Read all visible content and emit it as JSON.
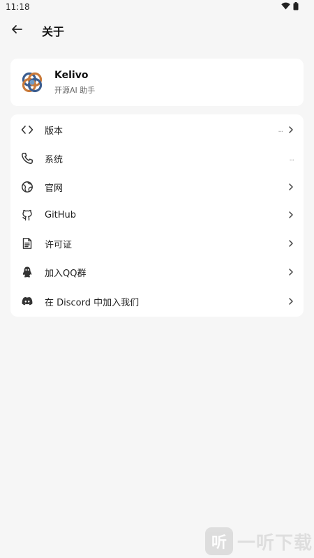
{
  "status": {
    "time": "11:18",
    "icons": [
      "wifi-icon",
      "battery-icon"
    ]
  },
  "header": {
    "title": "关于",
    "back_icon": "arrow-left-icon"
  },
  "app": {
    "name": "Kelivo",
    "description": "开源AI 助手",
    "logo_colors": [
      "#3b5d8f",
      "#c97a3a",
      "#6f9cc9"
    ]
  },
  "menu": {
    "items": [
      {
        "icon": "code-icon",
        "label": "版本",
        "value": "...",
        "chevron": true
      },
      {
        "icon": "phone-icon",
        "label": "系统",
        "value": "...",
        "chevron": false
      },
      {
        "icon": "globe-icon",
        "label": "官网",
        "value": "",
        "chevron": true
      },
      {
        "icon": "github-icon",
        "label": "GitHub",
        "value": "",
        "chevron": true
      },
      {
        "icon": "document-icon",
        "label": "许可证",
        "value": "",
        "chevron": true
      },
      {
        "icon": "qq-icon",
        "label": "加入QQ群",
        "value": "",
        "chevron": true
      },
      {
        "icon": "discord-icon",
        "label": "在 Discord 中加入我们",
        "value": "",
        "chevron": true
      }
    ]
  },
  "watermark": {
    "badge_char": "听",
    "text": "一听下载"
  }
}
